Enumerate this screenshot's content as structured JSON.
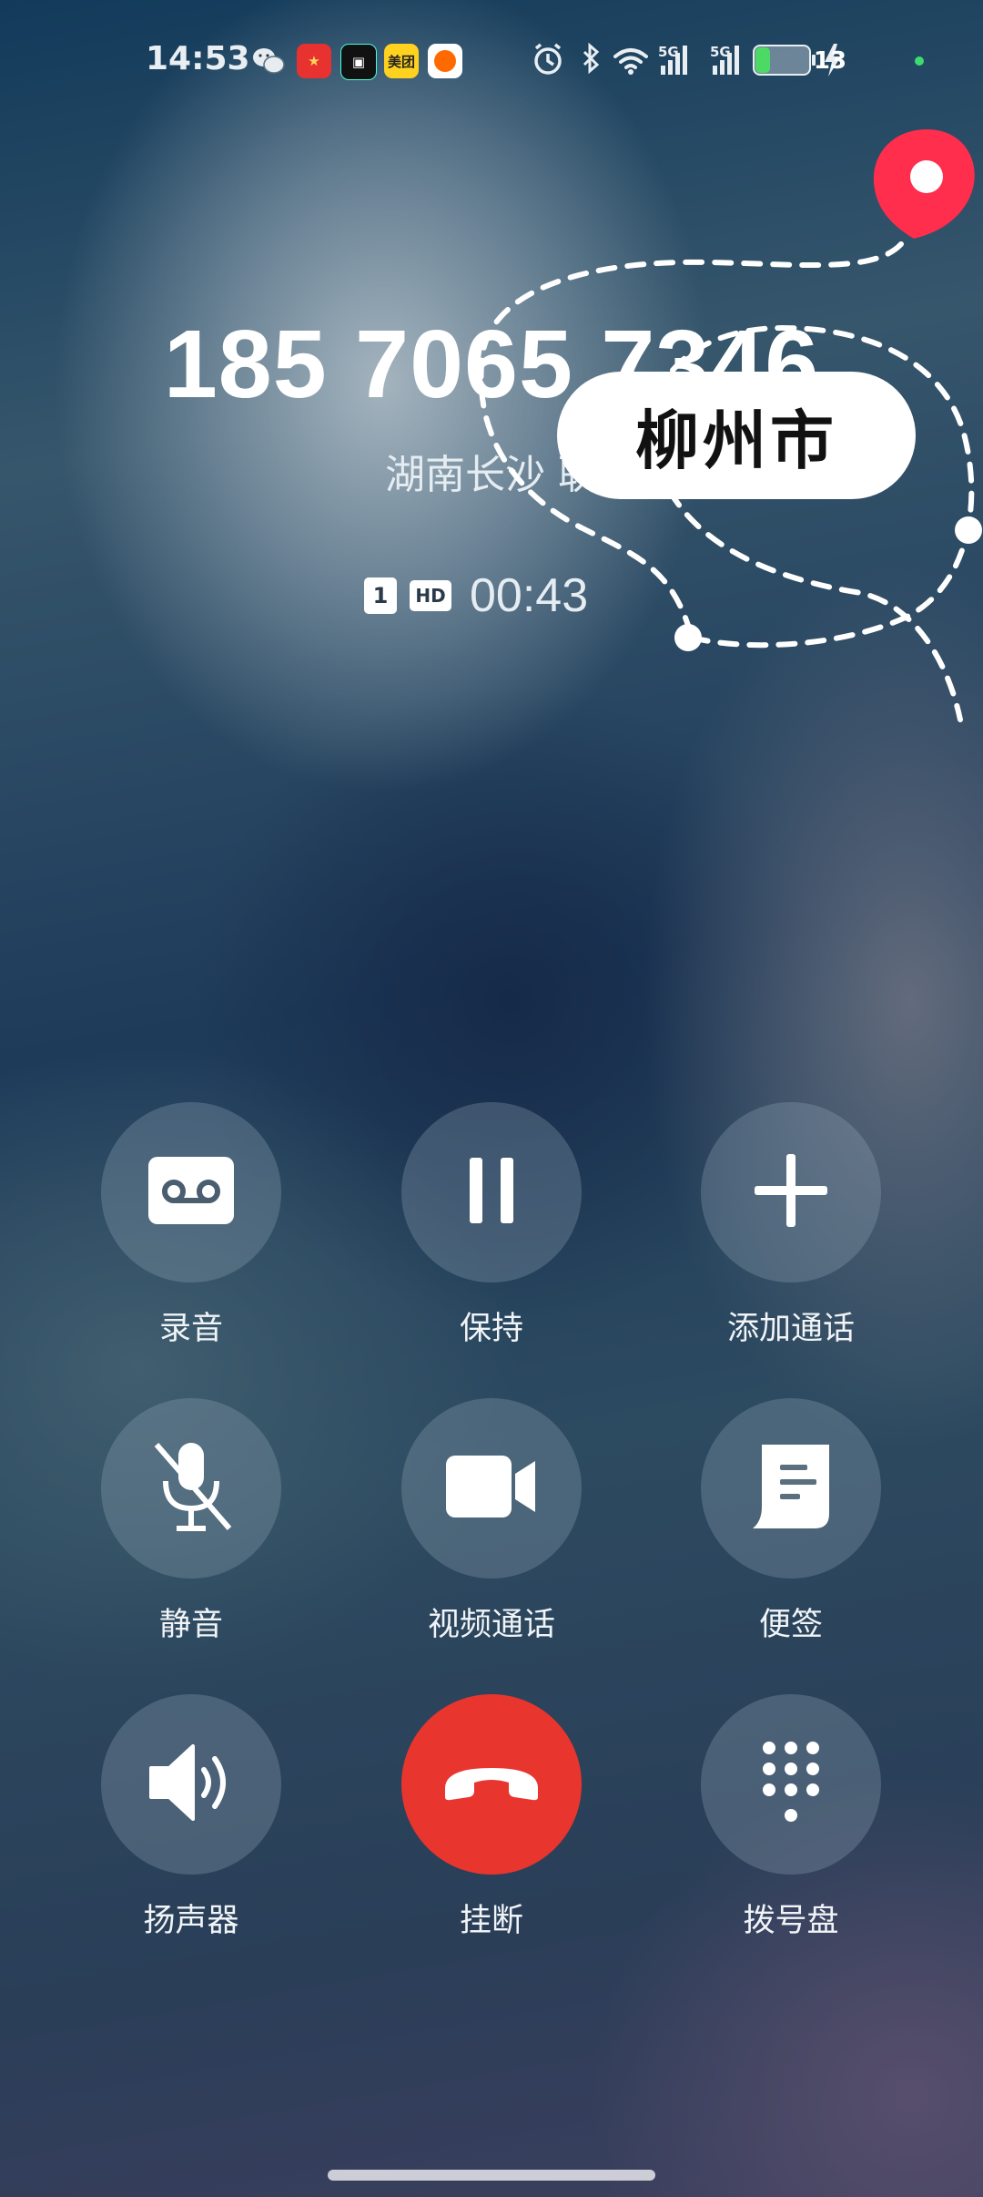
{
  "status_bar": {
    "time": "14:53",
    "apps": [
      "wechat-icon",
      "app-icon-red",
      "app-icon-black",
      "meituan-icon",
      "app-icon-orange"
    ],
    "meituan_label": "美团",
    "network_1": "5G",
    "network_2": "5G",
    "battery": "13",
    "battery_color": "#4cd964"
  },
  "call": {
    "number": "185 7065 7346",
    "location": "湖南长沙 联",
    "sim": "1",
    "hd": "HD",
    "duration": "00:43"
  },
  "annotation": {
    "city": "柳州市",
    "pin_color": "#ff2e4d"
  },
  "controls": [
    {
      "label": "录音",
      "icon": "record-icon"
    },
    {
      "label": "保持",
      "icon": "pause-icon"
    },
    {
      "label": "添加通话",
      "icon": "add-call-icon"
    },
    {
      "label": "静音",
      "icon": "mute-icon"
    },
    {
      "label": "视频通话",
      "icon": "video-call-icon"
    },
    {
      "label": "便签",
      "icon": "note-icon"
    },
    {
      "label": "扬声器",
      "icon": "speaker-icon"
    },
    {
      "label": "挂断",
      "icon": "hangup-icon"
    },
    {
      "label": "拨号盘",
      "icon": "dialpad-icon"
    }
  ],
  "colors": {
    "hangup": "#e8352e"
  }
}
